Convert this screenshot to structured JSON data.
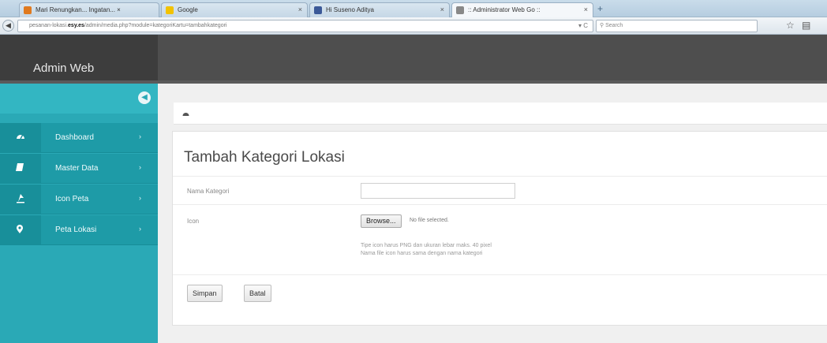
{
  "browser": {
    "tabs": [
      {
        "label": "Mari Renungkan... Ingatan... ×",
        "fav": "#e07a1f"
      },
      {
        "label": "Google",
        "fav": "#f2c200"
      },
      {
        "label": "Hi Suseno Aditya",
        "fav": "#3b5998"
      },
      {
        "label": ":: Administrator Web Go ::",
        "fav": "#888888"
      }
    ],
    "url_prefix": "pesanan-lokasi.",
    "url_domain": "esy.es",
    "url_path": "/admin/media.php?module=kategoriKartu=tambahkategori",
    "search_placeholder": "Search"
  },
  "header": {
    "brand": "Admin Web"
  },
  "sidebar": {
    "items": [
      {
        "label": "Dashboard",
        "icon": "dashboard-icon"
      },
      {
        "label": "Master Data",
        "icon": "database-icon"
      },
      {
        "label": "Icon Peta",
        "icon": "pin-icon"
      },
      {
        "label": "Peta Lokasi",
        "icon": "map-marker-icon"
      }
    ]
  },
  "form": {
    "title": "Tambah Kategori Lokasi",
    "nama_label": "Nama Kategori",
    "nama_value": "",
    "icon_label": "Icon",
    "browse_label": "Browse...",
    "no_file": "No file selected.",
    "help_1": "Tipe icon harus PNG dan ukuran lebar maks. 40 pixel",
    "help_2": "Nama file icon harus sama dengan nama kategori",
    "save_label": "Simpan",
    "cancel_label": "Batal"
  },
  "colors": {
    "sidebar": "#2aa9b6",
    "sidebar_item": "#1e9ba7",
    "header": "#4e4e4e"
  }
}
